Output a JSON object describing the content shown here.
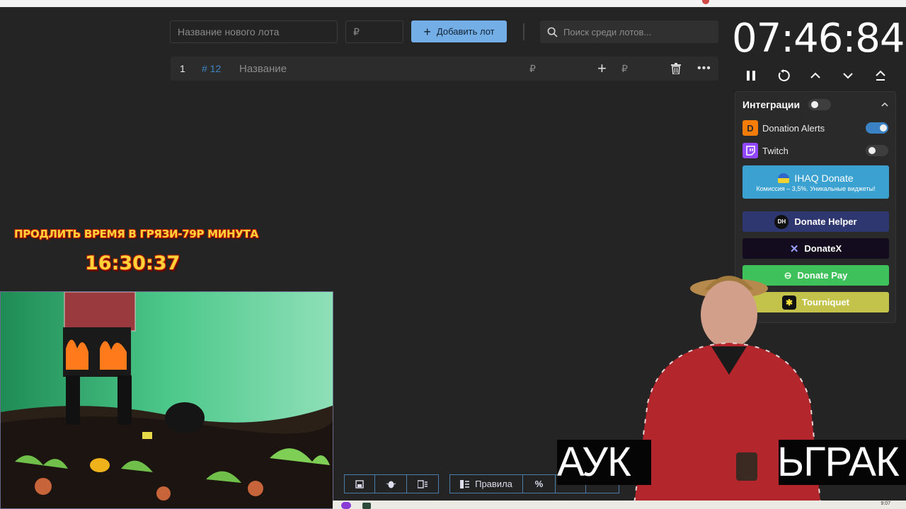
{
  "header": {
    "lot_name_placeholder": "Название нового лота",
    "price_placeholder": "₽",
    "add_button_label": "Добавить лот",
    "search_placeholder": "Поиск среди лотов..."
  },
  "lot": {
    "index": "1",
    "id": "# 12",
    "name_placeholder": "Название",
    "currency": "₽",
    "add_currency": "₽"
  },
  "timer": {
    "value": "07:46:84"
  },
  "integrations": {
    "title": "Интеграции",
    "master_enabled": false,
    "services": [
      {
        "label": "Donation Alerts",
        "enabled": true,
        "icon": "donation-alerts-icon",
        "color": "#f57d07"
      },
      {
        "label": "Twitch",
        "enabled": false,
        "icon": "twitch-icon",
        "color": "#9146ff"
      }
    ],
    "promo": {
      "title": "IHAQ Donate",
      "subtitle": "Комиссия – 3,5%. Уникальные виджеты!",
      "color": "#3aa1d0"
    },
    "cards": [
      {
        "label": "Donate Helper",
        "color": "#2f3770",
        "icon": "dh-icon"
      },
      {
        "label": "DonateX",
        "color": "#130c1f",
        "icon": "x-icon"
      },
      {
        "label": "Donate Pay",
        "color": "#3ec15a",
        "icon": "link-icon"
      },
      {
        "label": "Tourniquet",
        "color": "#c3c24b",
        "icon": "tourniquet-icon"
      }
    ]
  },
  "overlay": {
    "title": "ПРОДЛИТЬ ВРЕМЯ В ГРЯЗИ-79Р МИНУТА",
    "timer": "16:30:37"
  },
  "bottom_toolbar": {
    "rules_label": "Правила",
    "percent_label": "%"
  },
  "stream_banner": {
    "left_text": "АУК",
    "right_text": "ЬГРАК"
  },
  "taskbar": {
    "time": "9:07"
  }
}
